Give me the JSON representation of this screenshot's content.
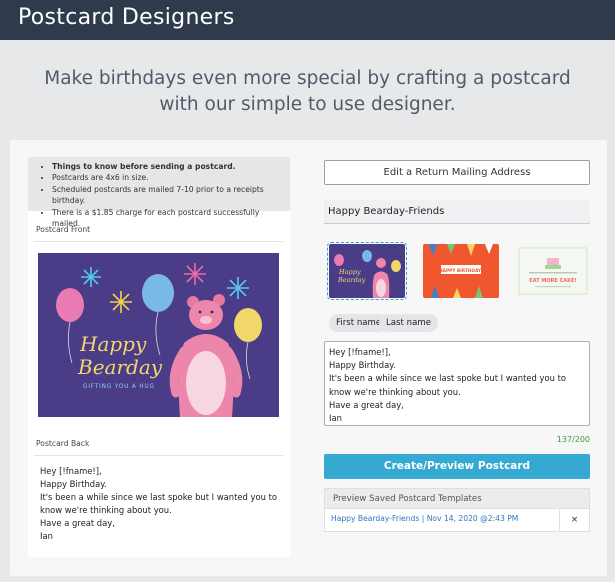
{
  "header": {
    "brand": "Postcard Designers"
  },
  "tagline": {
    "line1": "Make birthdays even more special by crafting a postcard",
    "line2": "with our simple to use designer."
  },
  "info": {
    "items": [
      "Things to know before sending a postcard.",
      "Postcards are 4x6 in size.",
      "Scheduled postcards are mailed 7-10 prior to a receipts birthday.",
      "There is a $1.85 charge for each postcard successfully mailed."
    ]
  },
  "front": {
    "label": "Postcard Front",
    "card": {
      "line1": "Happy",
      "line2": "Bearday",
      "subtitle": "GIFTING YOU A HUG"
    }
  },
  "back": {
    "label": "Postcard Back",
    "lines": [
      "Hey [!fname!],",
      "Happy Birthday.",
      "It's been a while since we last spoke but I wanted you to know we're thinking about you.",
      "Have a great day,",
      "Ian"
    ]
  },
  "editor": {
    "return_address_button": "Edit a Return Mailing Address",
    "title_value": "Happy Bearday-Friends",
    "templates": [
      {
        "name": "happy-bearday",
        "text1": "Happy",
        "text2": "Bearday",
        "selected": true
      },
      {
        "name": "happy-birthday-hats",
        "text1": "HAPPY BIRTHDAY!",
        "selected": false
      },
      {
        "name": "eat-more-cake",
        "text1": "EAT MORE CAKE!",
        "selected": false
      }
    ],
    "chips": {
      "first_name": "First name",
      "last_name": "Last name"
    },
    "message_lines": [
      "Hey [!fname!],",
      "Happy Birthday.",
      "It's been a while since we last spoke but I wanted you to know we're thinking about you.",
      "Have a great day,",
      "Ian"
    ],
    "char_count": "137/200",
    "create_button": "Create/Preview Postcard"
  },
  "saved": {
    "header": "Preview Saved Postcard Templates",
    "rows": [
      {
        "label": "Happy Bearday-Friends | Nov 14, 2020 @2:43 PM",
        "delete": "×"
      }
    ]
  },
  "colors": {
    "header_bg": "#2f3b4c",
    "accent": "#36a9d2",
    "card_purple": "#4a3c86",
    "card_orange": "#f0572f",
    "counter_green": "#3c9a3c",
    "link_blue": "#2f74c0"
  },
  "icons": {
    "delete": "close-icon"
  }
}
